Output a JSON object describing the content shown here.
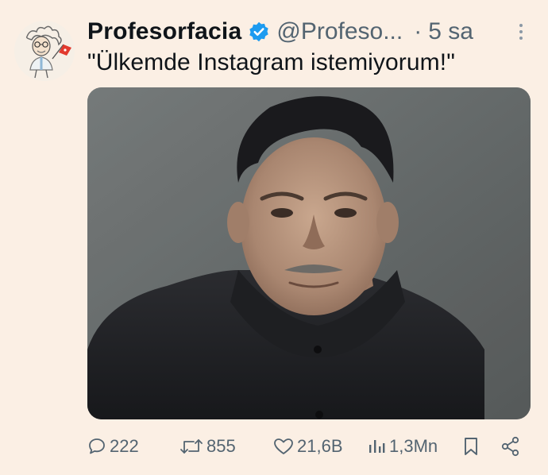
{
  "tweet": {
    "display_name": "Profesorfacia",
    "handle": "@Profeso...",
    "separator": "·",
    "time": "5 sa",
    "text": "\"Ülkemde Instagram istemiyorum!\""
  },
  "actions": {
    "replies": "222",
    "retweets": "855",
    "likes": "21,6B",
    "views": "1,3Mn"
  },
  "colors": {
    "background": "#fbefe4",
    "text": "#0f1419",
    "muted": "#536471",
    "verified": "#1d9bf0"
  },
  "icons": [
    "avatar-caricature",
    "verified-badge-icon",
    "more-icon",
    "reply-icon",
    "retweet-icon",
    "like-icon",
    "views-icon",
    "bookmark-icon",
    "share-icon"
  ]
}
